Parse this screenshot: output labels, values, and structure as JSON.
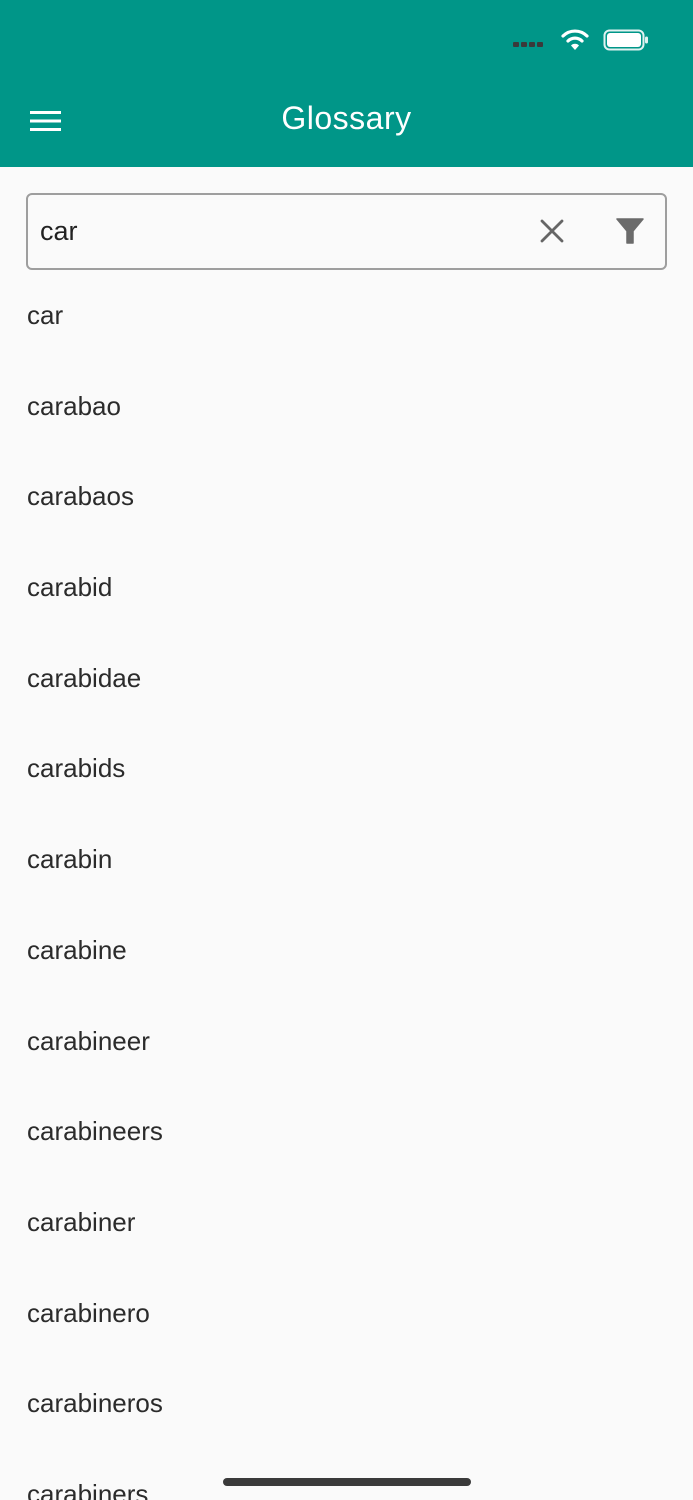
{
  "status_bar": {
    "icons": [
      "signal-icon",
      "wifi-icon",
      "battery-icon"
    ]
  },
  "header": {
    "title": "Glossary",
    "menu_icon": "hamburger-menu-icon",
    "background_color": "#009688"
  },
  "search": {
    "value": "car",
    "clear_icon": "close-icon",
    "filter_icon": "filter-icon"
  },
  "results": [
    "car",
    "carabao",
    "carabaos",
    "carabid",
    "carabidae",
    "carabids",
    "carabin",
    "carabine",
    "carabineer",
    "carabineers",
    "carabiner",
    "carabinero",
    "carabineros",
    "carabiners"
  ]
}
